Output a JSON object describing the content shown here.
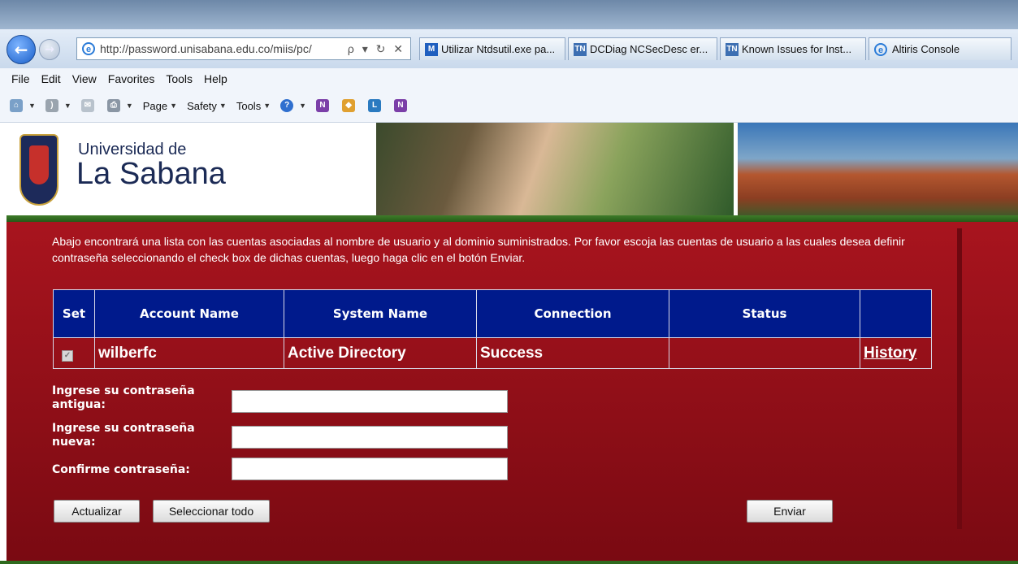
{
  "browser": {
    "address_url": "http://password.unisabana.edu.co/miis/pc/",
    "address_controls": "ρ ▾ ↻ ✕",
    "tabs": [
      {
        "label": "Utilizar Ntdsutil.exe pa...",
        "icon": "microsoft-icon"
      },
      {
        "label": "DCDiag NCSecDesc er...",
        "icon": "technet-icon"
      },
      {
        "label": "Known Issues for Inst...",
        "icon": "technet-icon"
      },
      {
        "label": "Altiris Console",
        "icon": "ie-icon"
      }
    ],
    "menu": [
      "File",
      "Edit",
      "View",
      "Favorites",
      "Tools",
      "Help"
    ],
    "toolbar": {
      "page": "Page",
      "safety": "Safety",
      "tools": "Tools"
    }
  },
  "header": {
    "logo_sub": "Universidad de",
    "logo_main": "La Sabana"
  },
  "page": {
    "instructions": "Abajo encontrará una lista con las cuentas asociadas al nombre de usuario y al dominio suministrados. Por favor escoja las cuentas de usuario a las cuales desea definir contraseña seleccionando el check box de dichas cuentas, luego haga clic en el botón Enviar.",
    "table": {
      "headers": [
        "Set",
        "Account Name",
        "System Name",
        "Connection",
        "Status",
        ""
      ],
      "rows": [
        {
          "set": "✓",
          "account": "wilberfc",
          "system": "Active Directory",
          "connection": "Success",
          "status": "",
          "link": "History"
        }
      ]
    },
    "form": {
      "old_password_label": "Ingrese su contraseña antigua:",
      "new_password_label": "Ingrese su contraseña nueva:",
      "confirm_label": "Confirme contraseña:"
    },
    "buttons": {
      "update": "Actualizar",
      "select_all": "Seleccionar todo",
      "submit": "Enviar"
    }
  },
  "colors": {
    "content_red": "#a8141e",
    "table_header_blue": "#001a8c",
    "band_green": "#3f7d2a"
  }
}
